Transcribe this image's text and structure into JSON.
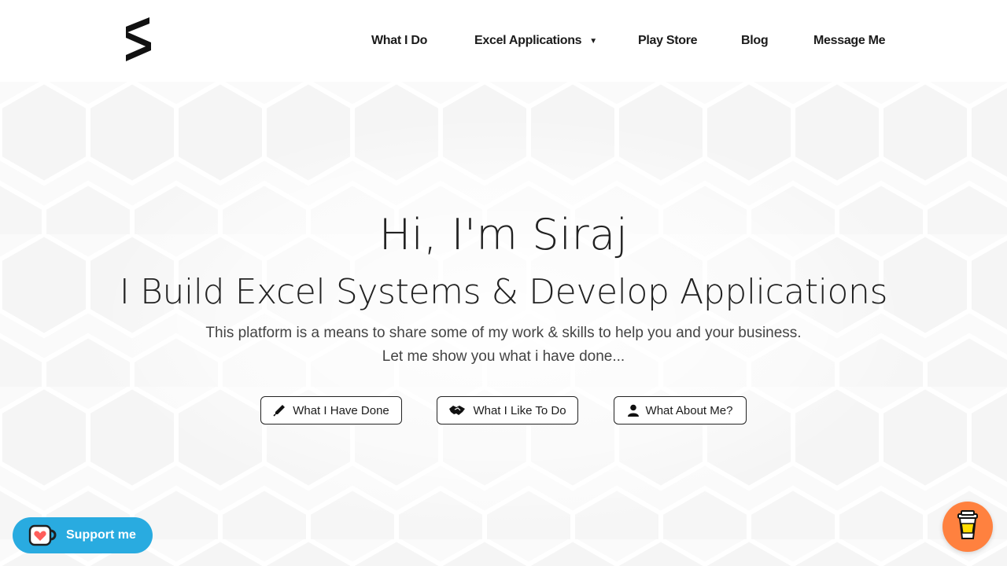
{
  "nav": {
    "items": [
      {
        "label": "What I Do"
      },
      {
        "label": "Excel Applications",
        "has_dropdown": true
      },
      {
        "label": "Play Store"
      },
      {
        "label": "Blog"
      },
      {
        "label": "Message Me"
      }
    ],
    "caret": "▼"
  },
  "hero": {
    "title": "Hi, I'm Siraj",
    "subtitle": "I Build Excel Systems & Develop Applications",
    "description_line1": "This platform is a means to share some of my work & skills to help you and your business.",
    "description_line2": "Let me show you what i have done..."
  },
  "buttons": [
    {
      "label": "What I Have Done",
      "icon": "pen-icon"
    },
    {
      "label": "What I Like To Do",
      "icon": "handshake-icon"
    },
    {
      "label": "What About Me?",
      "icon": "user-icon"
    }
  ],
  "support": {
    "label": "Support me",
    "icon": "kofi-cup-icon",
    "color": "#29abe0"
  },
  "bmc": {
    "icon": "coffee-cup-icon",
    "color": "#ff813f"
  }
}
